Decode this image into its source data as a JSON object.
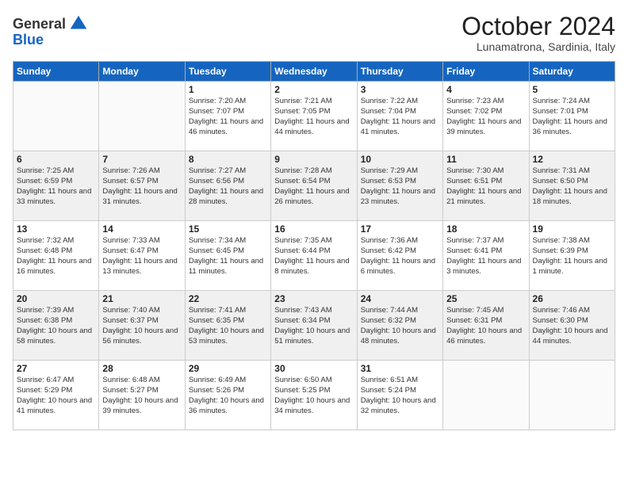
{
  "header": {
    "logo_line1": "General",
    "logo_line2": "Blue",
    "month": "October 2024",
    "location": "Lunamatrona, Sardinia, Italy"
  },
  "weekdays": [
    "Sunday",
    "Monday",
    "Tuesday",
    "Wednesday",
    "Thursday",
    "Friday",
    "Saturday"
  ],
  "weeks": [
    [
      {
        "day": "",
        "info": ""
      },
      {
        "day": "",
        "info": ""
      },
      {
        "day": "1",
        "info": "Sunrise: 7:20 AM\nSunset: 7:07 PM\nDaylight: 11 hours and 46 minutes."
      },
      {
        "day": "2",
        "info": "Sunrise: 7:21 AM\nSunset: 7:05 PM\nDaylight: 11 hours and 44 minutes."
      },
      {
        "day": "3",
        "info": "Sunrise: 7:22 AM\nSunset: 7:04 PM\nDaylight: 11 hours and 41 minutes."
      },
      {
        "day": "4",
        "info": "Sunrise: 7:23 AM\nSunset: 7:02 PM\nDaylight: 11 hours and 39 minutes."
      },
      {
        "day": "5",
        "info": "Sunrise: 7:24 AM\nSunset: 7:01 PM\nDaylight: 11 hours and 36 minutes."
      }
    ],
    [
      {
        "day": "6",
        "info": "Sunrise: 7:25 AM\nSunset: 6:59 PM\nDaylight: 11 hours and 33 minutes."
      },
      {
        "day": "7",
        "info": "Sunrise: 7:26 AM\nSunset: 6:57 PM\nDaylight: 11 hours and 31 minutes."
      },
      {
        "day": "8",
        "info": "Sunrise: 7:27 AM\nSunset: 6:56 PM\nDaylight: 11 hours and 28 minutes."
      },
      {
        "day": "9",
        "info": "Sunrise: 7:28 AM\nSunset: 6:54 PM\nDaylight: 11 hours and 26 minutes."
      },
      {
        "day": "10",
        "info": "Sunrise: 7:29 AM\nSunset: 6:53 PM\nDaylight: 11 hours and 23 minutes."
      },
      {
        "day": "11",
        "info": "Sunrise: 7:30 AM\nSunset: 6:51 PM\nDaylight: 11 hours and 21 minutes."
      },
      {
        "day": "12",
        "info": "Sunrise: 7:31 AM\nSunset: 6:50 PM\nDaylight: 11 hours and 18 minutes."
      }
    ],
    [
      {
        "day": "13",
        "info": "Sunrise: 7:32 AM\nSunset: 6:48 PM\nDaylight: 11 hours and 16 minutes."
      },
      {
        "day": "14",
        "info": "Sunrise: 7:33 AM\nSunset: 6:47 PM\nDaylight: 11 hours and 13 minutes."
      },
      {
        "day": "15",
        "info": "Sunrise: 7:34 AM\nSunset: 6:45 PM\nDaylight: 11 hours and 11 minutes."
      },
      {
        "day": "16",
        "info": "Sunrise: 7:35 AM\nSunset: 6:44 PM\nDaylight: 11 hours and 8 minutes."
      },
      {
        "day": "17",
        "info": "Sunrise: 7:36 AM\nSunset: 6:42 PM\nDaylight: 11 hours and 6 minutes."
      },
      {
        "day": "18",
        "info": "Sunrise: 7:37 AM\nSunset: 6:41 PM\nDaylight: 11 hours and 3 minutes."
      },
      {
        "day": "19",
        "info": "Sunrise: 7:38 AM\nSunset: 6:39 PM\nDaylight: 11 hours and 1 minute."
      }
    ],
    [
      {
        "day": "20",
        "info": "Sunrise: 7:39 AM\nSunset: 6:38 PM\nDaylight: 10 hours and 58 minutes."
      },
      {
        "day": "21",
        "info": "Sunrise: 7:40 AM\nSunset: 6:37 PM\nDaylight: 10 hours and 56 minutes."
      },
      {
        "day": "22",
        "info": "Sunrise: 7:41 AM\nSunset: 6:35 PM\nDaylight: 10 hours and 53 minutes."
      },
      {
        "day": "23",
        "info": "Sunrise: 7:43 AM\nSunset: 6:34 PM\nDaylight: 10 hours and 51 minutes."
      },
      {
        "day": "24",
        "info": "Sunrise: 7:44 AM\nSunset: 6:32 PM\nDaylight: 10 hours and 48 minutes."
      },
      {
        "day": "25",
        "info": "Sunrise: 7:45 AM\nSunset: 6:31 PM\nDaylight: 10 hours and 46 minutes."
      },
      {
        "day": "26",
        "info": "Sunrise: 7:46 AM\nSunset: 6:30 PM\nDaylight: 10 hours and 44 minutes."
      }
    ],
    [
      {
        "day": "27",
        "info": "Sunrise: 6:47 AM\nSunset: 5:29 PM\nDaylight: 10 hours and 41 minutes."
      },
      {
        "day": "28",
        "info": "Sunrise: 6:48 AM\nSunset: 5:27 PM\nDaylight: 10 hours and 39 minutes."
      },
      {
        "day": "29",
        "info": "Sunrise: 6:49 AM\nSunset: 5:26 PM\nDaylight: 10 hours and 36 minutes."
      },
      {
        "day": "30",
        "info": "Sunrise: 6:50 AM\nSunset: 5:25 PM\nDaylight: 10 hours and 34 minutes."
      },
      {
        "day": "31",
        "info": "Sunrise: 6:51 AM\nSunset: 5:24 PM\nDaylight: 10 hours and 32 minutes."
      },
      {
        "day": "",
        "info": ""
      },
      {
        "day": "",
        "info": ""
      }
    ]
  ]
}
